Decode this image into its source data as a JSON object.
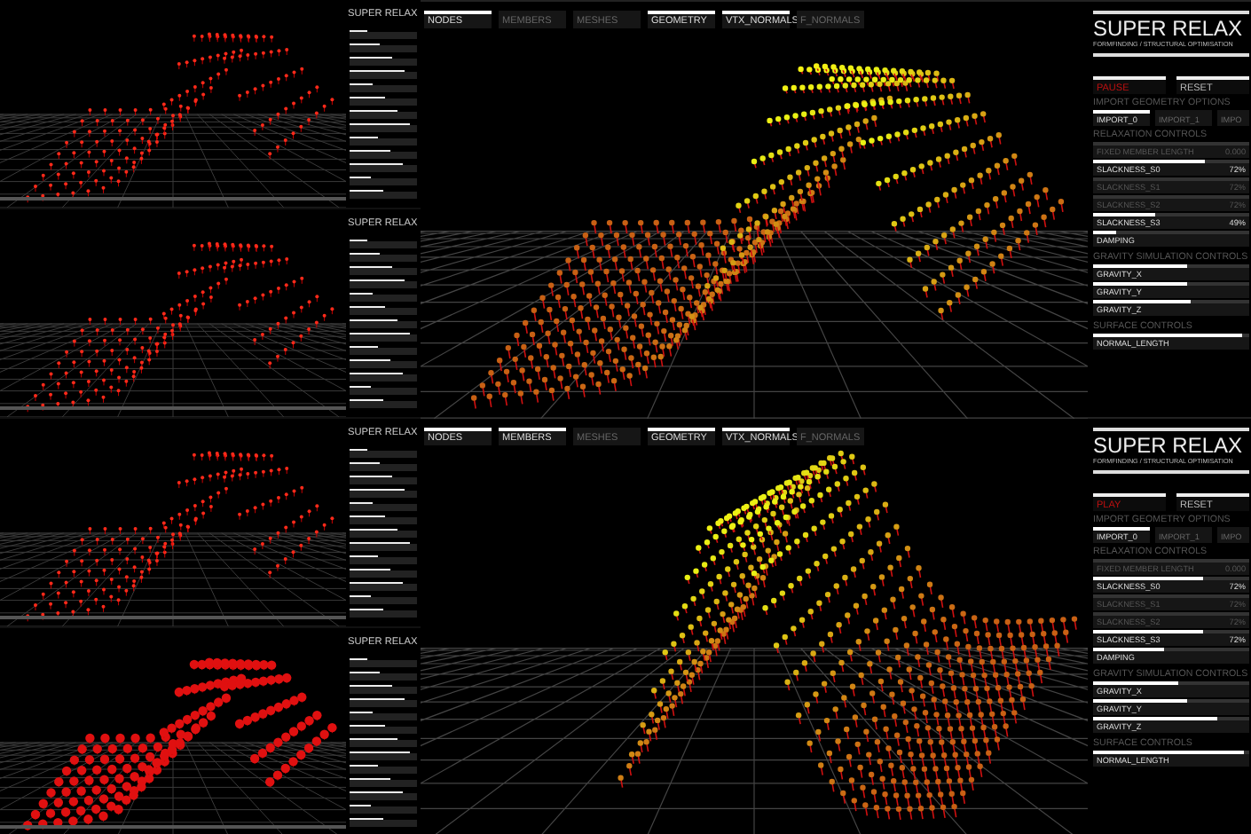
{
  "thumbnails": [
    {
      "panel_title": "SUPER RELAX"
    },
    {
      "panel_title": "SUPER RELAX"
    },
    {
      "panel_title": "SUPER RELAX"
    },
    {
      "panel_title": "SUPER RELAX"
    }
  ],
  "views": [
    {
      "toolbar": [
        {
          "label": "NODES",
          "selected": true
        },
        {
          "label": "MEMBERS",
          "selected": false
        },
        {
          "label": "MESHES",
          "selected": false
        },
        {
          "label": "GEOMETRY",
          "selected": true
        },
        {
          "label": "VTX_NORMALS",
          "selected": true
        },
        {
          "label": "F_NORMALS",
          "selected": false
        }
      ],
      "panel": {
        "title": "SUPER RELAX",
        "subtitle": "FORMFINDING / STRUCTURAL OPTIMISATION",
        "run_button": "PAUSE",
        "reset_button": "RESET",
        "sections": [
          {
            "heading": "IMPORT GEOMETRY OPTIONS",
            "kind": "imports",
            "items": [
              {
                "label": "IMPORT_0",
                "selected": true
              },
              {
                "label": "IMPORT_1",
                "selected": false
              },
              {
                "label": "IMPO",
                "selected": false
              }
            ]
          },
          {
            "heading": "RELAXATION CONTROLS",
            "kind": "sliders",
            "items": [
              {
                "label": "FIXED MEMBER LENGTH",
                "reading": "0.000",
                "disabled": true
              },
              {
                "label": "SLACKNESS_S0",
                "reading": "72%",
                "level": 0.72,
                "disabled": false
              },
              {
                "label": "SLACKNESS_S1",
                "reading": "72%",
                "disabled": true
              },
              {
                "label": "SLACKNESS_S2",
                "reading": "72%",
                "disabled": true
              },
              {
                "label": "SLACKNESS_S3",
                "reading": "49%",
                "level": 0.4,
                "disabled": false
              },
              {
                "label": "DAMPING",
                "level": 0.15,
                "disabled": false
              }
            ]
          },
          {
            "heading": "GRAVITY SIMULATION CONTROLS",
            "kind": "sliders",
            "items": [
              {
                "label": "GRAVITY_X",
                "level": 0.6,
                "disabled": false
              },
              {
                "label": "GRAVITY_Y",
                "level": 0.6,
                "disabled": false
              },
              {
                "label": "GRAVITY_Z",
                "level": 0.63,
                "disabled": false
              }
            ]
          },
          {
            "heading": "SURFACE CONTROLS",
            "kind": "sliders",
            "items": [
              {
                "label": "NORMAL_LENGTH",
                "level": 0.95,
                "disabled": false
              }
            ]
          }
        ]
      }
    },
    {
      "toolbar": [
        {
          "label": "NODES",
          "selected": true
        },
        {
          "label": "MEMBERS",
          "selected": true
        },
        {
          "label": "MESHES",
          "selected": false
        },
        {
          "label": "GEOMETRY",
          "selected": true
        },
        {
          "label": "VTX_NORMALS",
          "selected": true
        },
        {
          "label": "F_NORMALS",
          "selected": false
        }
      ],
      "panel": {
        "title": "SUPER RELAX",
        "subtitle": "FORMFINDING / STRUCTURAL OPTIMISATION",
        "run_button": "PLAY",
        "reset_button": "RESET",
        "sections": [
          {
            "heading": "IMPORT GEOMETRY OPTIONS",
            "kind": "imports",
            "items": [
              {
                "label": "IMPORT_0",
                "selected": true
              },
              {
                "label": "IMPORT_1",
                "selected": false
              },
              {
                "label": "IMPO",
                "selected": false
              }
            ]
          },
          {
            "heading": "RELAXATION CONTROLS",
            "kind": "sliders",
            "items": [
              {
                "label": "FIXED MEMBER LENGTH",
                "reading": "0.000",
                "disabled": true
              },
              {
                "label": "SLACKNESS_S0",
                "reading": "72%",
                "level": 0.7,
                "disabled": false
              },
              {
                "label": "SLACKNESS_S1",
                "reading": "72%",
                "disabled": true
              },
              {
                "label": "SLACKNESS_S2",
                "reading": "72%",
                "disabled": true
              },
              {
                "label": "SLACKNESS_S3",
                "reading": "72%",
                "level": 0.7,
                "disabled": false
              },
              {
                "label": "DAMPING",
                "level": 0.45,
                "disabled": false
              }
            ]
          },
          {
            "heading": "GRAVITY SIMULATION CONTROLS",
            "kind": "sliders",
            "items": [
              {
                "label": "GRAVITY_X",
                "level": 0.55,
                "disabled": false
              },
              {
                "label": "GRAVITY_Y",
                "level": 0.6,
                "disabled": false
              },
              {
                "label": "GRAVITY_Z",
                "level": 0.8,
                "disabled": false
              }
            ]
          },
          {
            "heading": "SURFACE CONTROLS",
            "kind": "sliders",
            "items": [
              {
                "label": "NORMAL_LENGTH",
                "level": 0.97,
                "disabled": false
              }
            ]
          }
        ]
      }
    }
  ]
}
